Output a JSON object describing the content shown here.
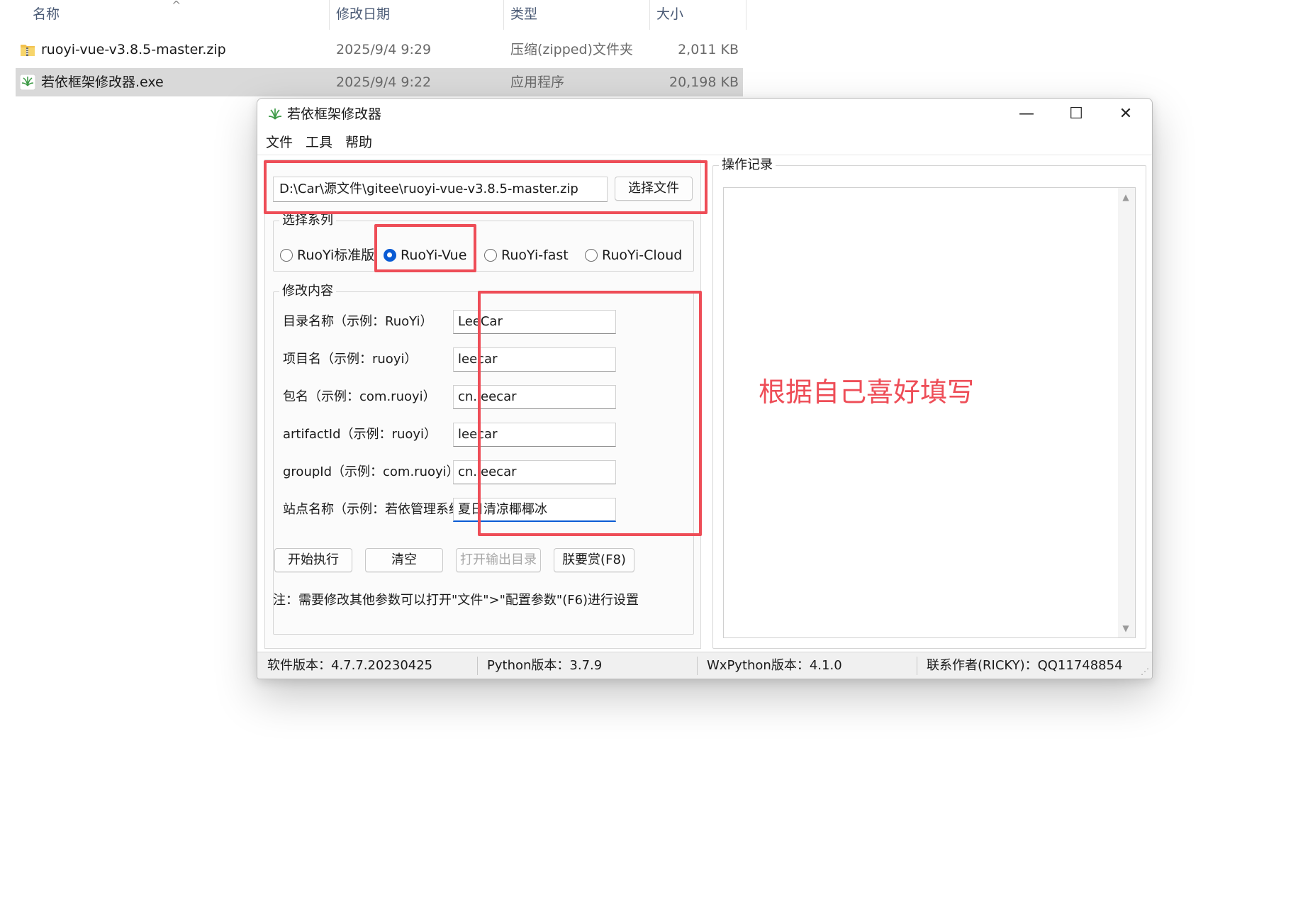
{
  "explorer": {
    "columns": {
      "name": "名称",
      "modified": "修改日期",
      "type": "类型",
      "size": "大小"
    },
    "files": [
      {
        "name": "ruoyi-vue-v3.8.5-master.zip",
        "modified": "2025/9/4 9:29",
        "type": "压缩(zipped)文件夹",
        "size": "2,011 KB",
        "icon": "zip-folder-icon"
      },
      {
        "name": "若依框架修改器.exe",
        "modified": "2025/9/4 9:22",
        "type": "应用程序",
        "size": "20,198 KB",
        "icon": "app-exe-icon",
        "selected": true
      }
    ]
  },
  "window": {
    "title": "若依框架修改器",
    "controls": {
      "minimize": "—",
      "maximize": "☐",
      "close": "✕"
    },
    "menu": [
      "文件",
      "工具",
      "帮助"
    ],
    "file_path": "D:\\Car\\源文件\\gitee\\ruoyi-vue-v3.8.5-master.zip",
    "choose_file_button": "选择文件",
    "series": {
      "legend": "选择系列",
      "options": [
        "RuoYi标准版",
        "RuoYi-Vue",
        "RuoYi-fast",
        "RuoYi-Cloud"
      ],
      "selected": "RuoYi-Vue"
    },
    "modify": {
      "legend": "修改内容",
      "fields": [
        {
          "label": "目录名称（示例：RuoYi）",
          "value": "LeeCar"
        },
        {
          "label": "项目名（示例：ruoyi）",
          "value": "leecar"
        },
        {
          "label": "包名（示例：com.ruoyi）",
          "value": "cn.leecar"
        },
        {
          "label": "artifactId（示例：ruoyi）",
          "value": "leecar"
        },
        {
          "label": "groupId（示例：com.ruoyi）",
          "value": "cn.leecar"
        },
        {
          "label": "站点名称（示例：若依管理系统）",
          "value": "夏日清凉椰椰冰"
        }
      ]
    },
    "buttons": {
      "start": "开始执行",
      "clear": "清空",
      "open_output": "打开输出目录",
      "donate": "朕要赏(F8)"
    },
    "note": "注：需要修改其他参数可以打开\"文件\">\"配置参数\"(F6)进行设置",
    "log": {
      "legend": "操作记录"
    },
    "status": {
      "version": "软件版本：4.7.7.20230425",
      "python": "Python版本：3.7.9",
      "wxpython": "WxPython版本：4.1.0",
      "contact": "联系作者(RICKY)：QQ11748854"
    }
  },
  "annotation": {
    "text": "根据自己喜好填写",
    "color": "#ee4d57"
  }
}
